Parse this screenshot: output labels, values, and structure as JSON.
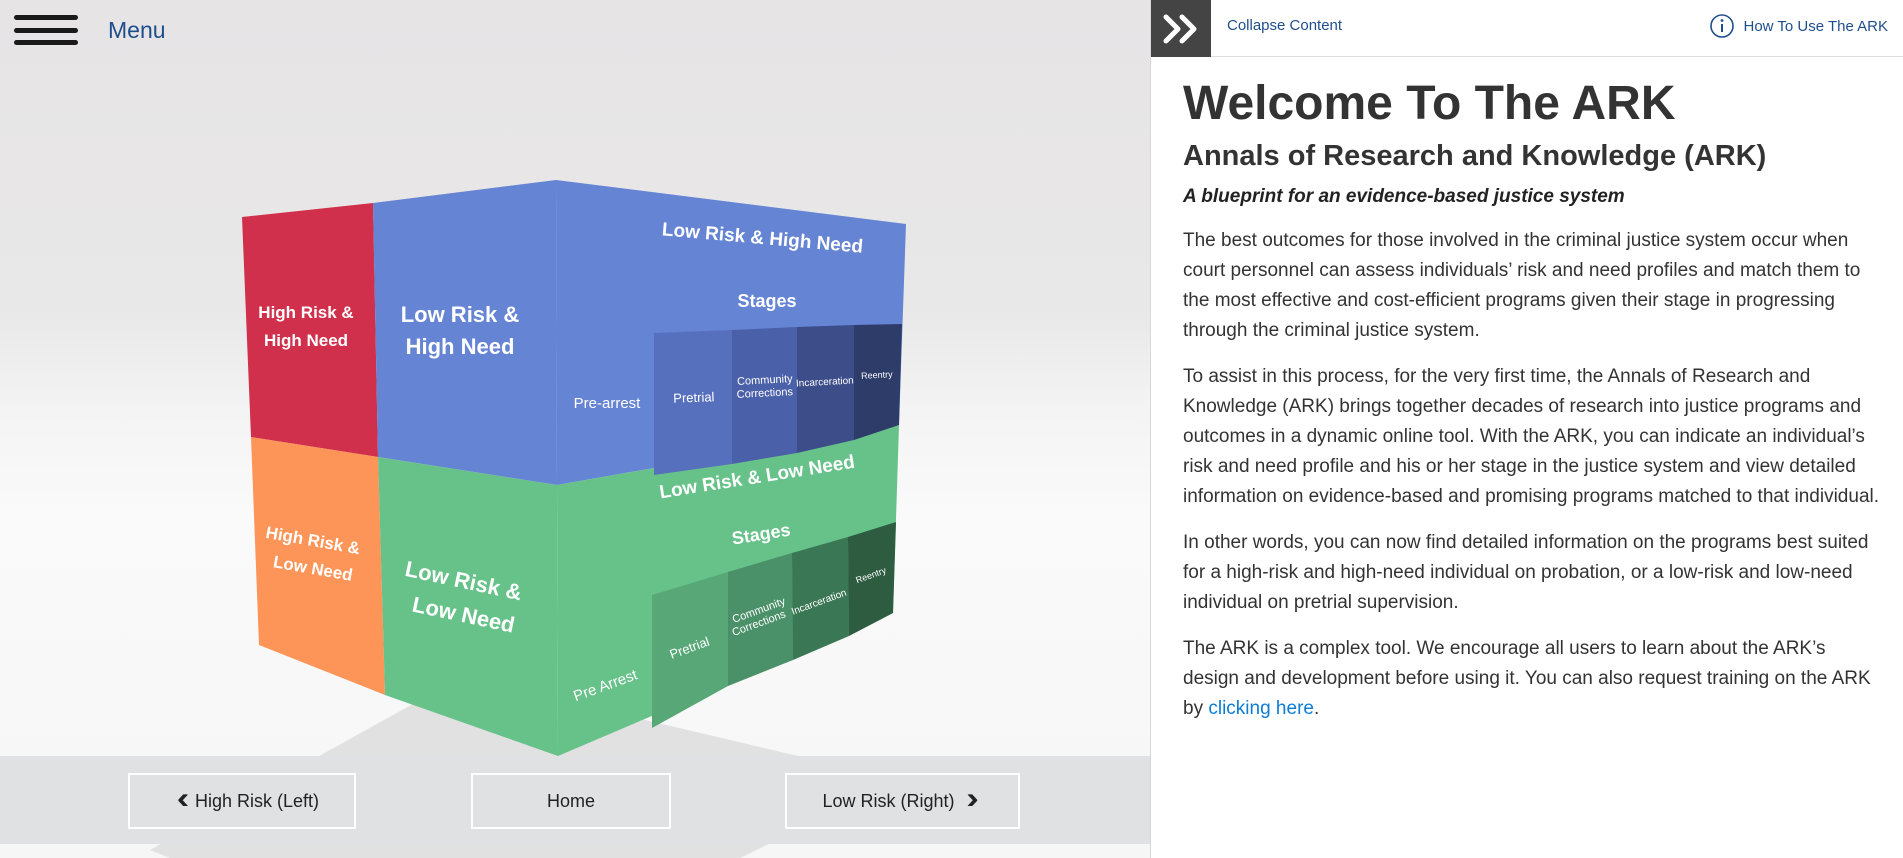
{
  "menu": {
    "label": "Menu"
  },
  "cube": {
    "front_left_top": "High Risk & High Need",
    "front_left_bottom": "High Risk & Low Need",
    "front_right_top": "Low Risk & High Need",
    "front_right_bottom": "Low Risk & Low Need",
    "side_top_title": "Low Risk & High Need",
    "side_bottom_title": "Low Risk & Low Need",
    "stages_label": "Stages",
    "top_stages": [
      "Pre-arrest",
      "Pretrial",
      "Community Corrections",
      "Incarceration",
      "Reentry"
    ],
    "bottom_stages": [
      "Pre Arrest",
      "Pretrial",
      "Community Corrections",
      "Incarceration",
      "Reentry"
    ],
    "colors": {
      "high_high": "#d0304b",
      "high_low": "#fd9458",
      "low_high": "#6584d4",
      "low_low": "#67c28a"
    }
  },
  "nav": {
    "left_label": "High Risk (Left)",
    "home_label": "Home",
    "right_label": "Low Risk (Right)"
  },
  "header": {
    "collapse_label": "Collapse Content",
    "howto_label": "How To Use The ARK"
  },
  "content": {
    "title": "Welcome To The ARK",
    "subtitle": "Annals of Research and Knowledge (ARK)",
    "tagline": "A blueprint for an evidence-based justice system",
    "p1": "The best outcomes for those involved in the criminal justice system occur when court personnel can assess individuals’ risk and need profiles and match them to the most effective and cost-efficient programs given their stage in progressing through the criminal justice system.",
    "p2": "To assist in this process, for the very first time, the Annals of Research and Knowledge (ARK) brings together decades of research into justice programs and outcomes in a dynamic online tool. With the ARK, you can indicate an individual’s risk and need profile and his or her stage in the justice system and view detailed information on evidence-based and promising programs matched to that individual.",
    "p3": "In other words, you can now find detailed information on the programs best suited for a high-risk and high-need individual on probation, or a low-risk and low-need individual on pretrial supervision.",
    "p4_text": "The ARK is a complex tool. We encourage all users to learn about the ARK’s design and development before using it. You can also request training on the ARK by",
    "p4_link": "clicking here",
    "p4_end": "."
  }
}
